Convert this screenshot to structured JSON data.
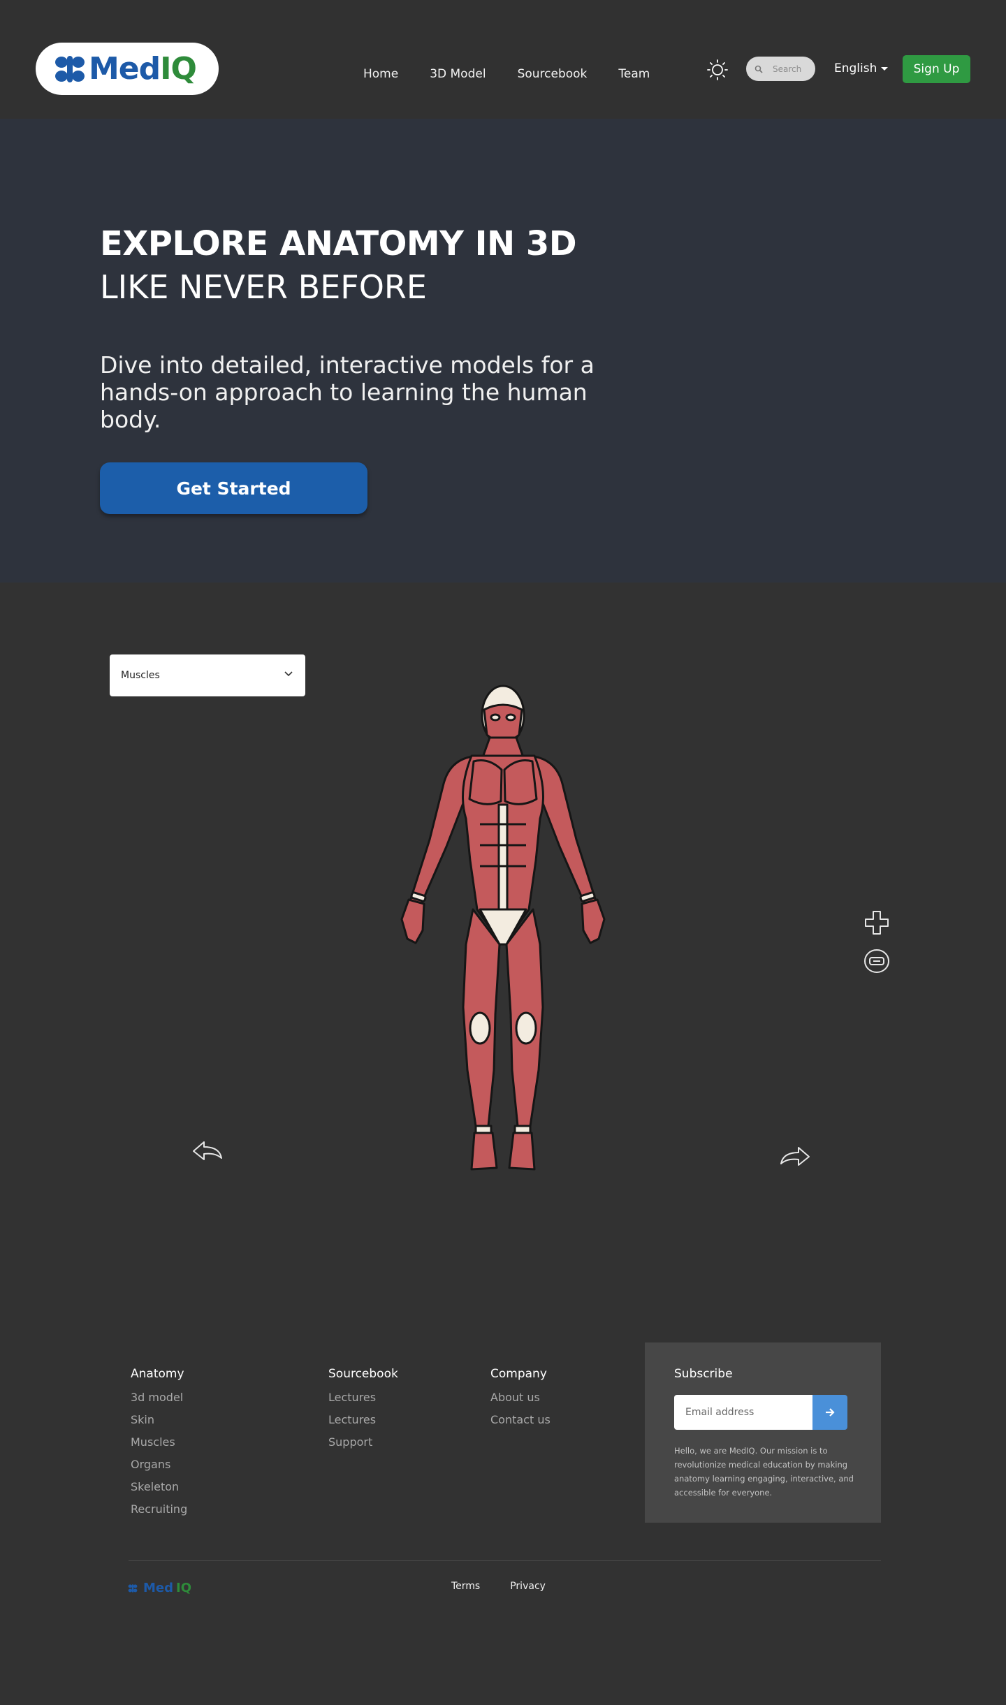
{
  "brand": {
    "name_part1": "Med",
    "name_part2": "IQ"
  },
  "nav": {
    "links": [
      "Home",
      "3D Model",
      "Sourcebook",
      "Team"
    ],
    "search_placeholder": "Search",
    "language": "English",
    "signup_label": "Sign Up",
    "theme_icon": "sun-icon"
  },
  "hero": {
    "title": "EXPLORE ANATOMY IN 3D",
    "subtitle": "LIKE NEVER BEFORE",
    "description": "Dive into detailed, interactive models for a hands-on approach to learning the human body.",
    "cta_label": "Get Started"
  },
  "viewer": {
    "layer_selected": "Muscles",
    "controls": [
      "zoom-in-icon",
      "zoom-out-icon",
      "rotate-left-icon",
      "rotate-right-icon"
    ]
  },
  "footer": {
    "anatomy": {
      "heading": "Anatomy",
      "links": [
        "3d model",
        "Skin",
        "Muscles",
        "Organs",
        "Skeleton",
        "Recruiting"
      ]
    },
    "sourcebook": {
      "heading": "Sourcebook",
      "links": [
        "Lectures",
        "Lectures",
        "Support"
      ]
    },
    "company": {
      "heading": "Company",
      "links": [
        "About us",
        "Contact us"
      ]
    },
    "subscribe": {
      "heading": "Subscribe",
      "email_placeholder": "Email address",
      "blurb": "Hello, we are MedIQ. Our mission is to revolutionize medical education by making anatomy learning engaging, interactive, and accessible for everyone."
    },
    "bottom_links": [
      "Terms",
      "Privacy"
    ]
  },
  "colors": {
    "brand_blue": "#1d5aa8",
    "brand_green": "#2e8b3a",
    "signup_green": "#2f9a42",
    "cta_blue": "#1c5eaa",
    "hero_bg": "#2e333d",
    "page_bg": "#323232"
  }
}
